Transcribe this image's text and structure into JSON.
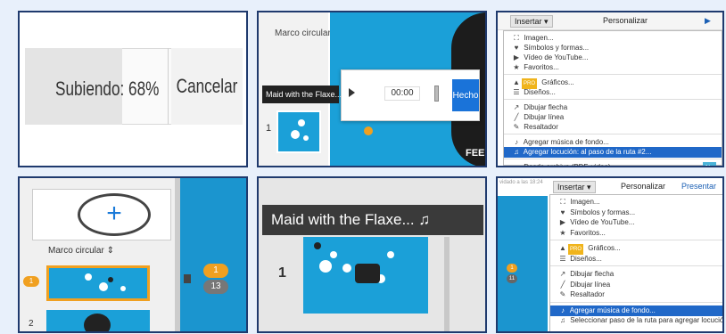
{
  "tile1": {
    "uploading_label": "Subiendo: 68%",
    "cancel_label": "Cancelar",
    "upload_progress": 0.68
  },
  "tile2": {
    "frame_label": "Marco circular",
    "track_title": "Maid with the Flaxe... ♫",
    "slide_number": "1",
    "time_value": "00:00",
    "done_label": "Hecho",
    "corner_text": "FEEL"
  },
  "tile3": {
    "insert_label": "Insertar ▾",
    "personalize_label": "Personalizar",
    "items": [
      {
        "icon": "image-icon",
        "glyph": "⛶",
        "label": "Imagen..."
      },
      {
        "icon": "symbols-icon",
        "glyph": "♥",
        "label": "Símbolos y formas..."
      },
      {
        "icon": "youtube-icon",
        "glyph": "▶",
        "label": "Vídeo de YouTube..."
      },
      {
        "icon": "favorites-icon",
        "glyph": "★",
        "label": "Favoritos..."
      },
      {
        "icon": "charts-icon",
        "glyph": "▲",
        "label": "Gráficos...",
        "badge": "PRO"
      },
      {
        "icon": "layouts-icon",
        "glyph": "☰",
        "label": "Diseños..."
      },
      {
        "icon": "arrow-icon",
        "glyph": "↗",
        "label": "Dibujar flecha"
      },
      {
        "icon": "line-icon",
        "glyph": "╱",
        "label": "Dibujar línea"
      },
      {
        "icon": "highlighter-icon",
        "glyph": "✎",
        "label": "Resaltador"
      },
      {
        "icon": "music-icon",
        "glyph": "♪",
        "label": "Agregar música de fondo..."
      },
      {
        "icon": "voiceover-icon",
        "glyph": "♫",
        "label": "Agregar locución: al paso de la ruta #2...",
        "selected": true
      },
      {
        "icon": "file-icon",
        "glyph": "▬",
        "label": "Desde archivo (PDF, video)...",
        "badge_new": "Nu"
      }
    ]
  },
  "tile4": {
    "frame_label": "Marco circular ⇕",
    "slide1_number": "1",
    "slide2_number": "2",
    "badge_one": "1",
    "badge_thirteen": "13"
  },
  "tile5": {
    "track_title": "Maid with the Flaxe... ♫",
    "slide_number": "1"
  },
  "tile6": {
    "saved_text": "vidado a las 18:24",
    "insert_label": "Insertar ▾",
    "personalize_label": "Personalizar",
    "present_label": "Presentar",
    "badge_one": "1",
    "badge_eleven": "11",
    "items": [
      {
        "icon": "image-icon",
        "glyph": "⛶",
        "label": "Imagen..."
      },
      {
        "icon": "symbols-icon",
        "glyph": "♥",
        "label": "Símbolos y formas..."
      },
      {
        "icon": "youtube-icon",
        "glyph": "▶",
        "label": "Vídeo de YouTube..."
      },
      {
        "icon": "favorites-icon",
        "glyph": "★",
        "label": "Favoritos..."
      },
      {
        "icon": "charts-icon",
        "glyph": "▲",
        "label": "Gráficos...",
        "badge": "PRO"
      },
      {
        "icon": "layouts-icon",
        "glyph": "☰",
        "label": "Diseños..."
      },
      {
        "icon": "arrow-icon",
        "glyph": "↗",
        "label": "Dibujar flecha"
      },
      {
        "icon": "line-icon",
        "glyph": "╱",
        "label": "Dibujar línea"
      },
      {
        "icon": "highlighter-icon",
        "glyph": "✎",
        "label": "Resaltador"
      },
      {
        "icon": "music-icon",
        "glyph": "♪",
        "label": "Agregar música de fondo...",
        "selected": true
      },
      {
        "icon": "voiceover-icon",
        "glyph": "♫",
        "label": "Seleccionar paso de la ruta para agregar locución"
      }
    ]
  },
  "colors": {
    "accent_blue": "#1a73d9",
    "canvas_blue": "#1ba0d8",
    "orange": "#f0a020",
    "selected": "#2068c8"
  }
}
